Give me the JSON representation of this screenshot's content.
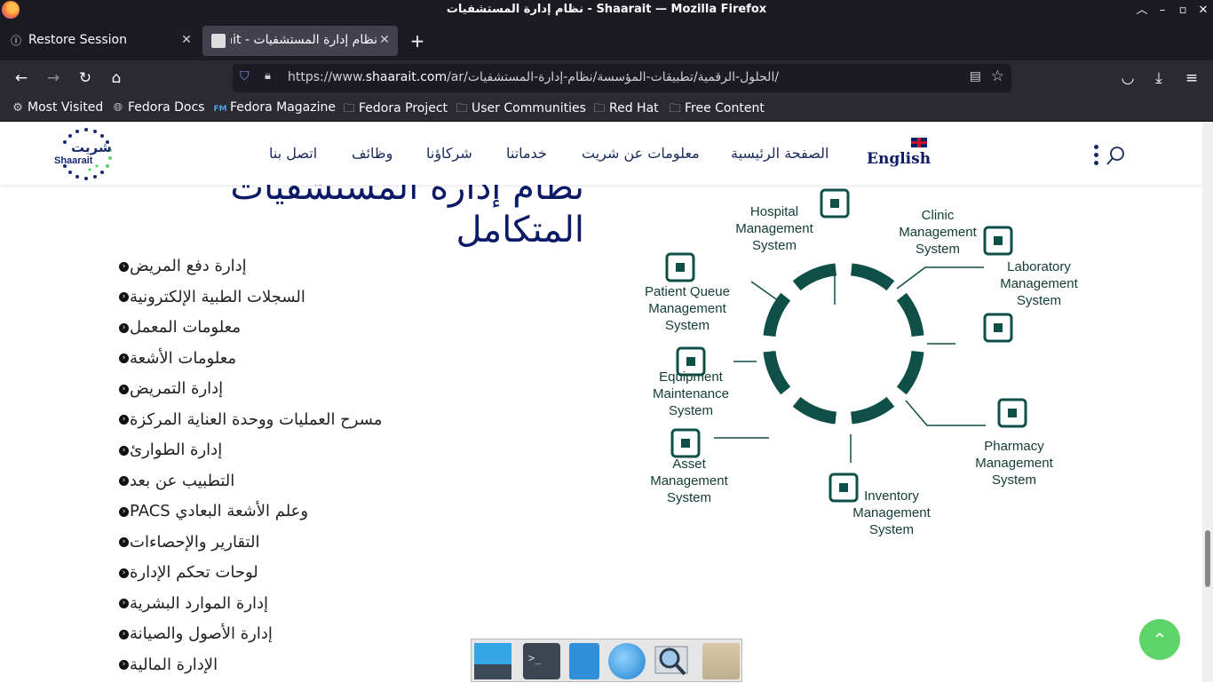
{
  "window": {
    "title": "نظام إدارة المستشفيات - Shaarait — Mozilla Firefox"
  },
  "tabs": [
    {
      "label": "Restore Session",
      "active": false
    },
    {
      "label": "نظام إدارة المستشفيات - Shaarait",
      "active": true
    }
  ],
  "url": {
    "prefix": "https://www.",
    "domain": "shaarait.com",
    "path": "/ar/الحلول-الرقمية/تطبيقات-المؤسسة/نظام-إدارة-المستشفيات/"
  },
  "bookmarks": [
    "Most Visited",
    "Fedora Docs",
    "Fedora Magazine",
    "Fedora Project",
    "User Communities",
    "Red Hat",
    "Free Content"
  ],
  "site": {
    "logo_text": "شريت",
    "logo_sub": "Shaarait",
    "menu": [
      "الصفحة الرئيسية",
      "معلومات عن شريت",
      "خدماتنا",
      "شركاؤنا",
      "وظائف",
      "اتصل بنا"
    ],
    "lang_label": "English"
  },
  "heading": {
    "line1": "نظام إدارة المستشفيات",
    "line2": "المتكامل"
  },
  "features": [
    "إدارة دفع المريض",
    "السجلات الطبية الإلكترونية",
    "معلومات المعمل",
    "معلومات الأشعة",
    "إدارة التمريض",
    "مسرح العمليات ووحدة العناية المركزة",
    "إدارة الطوارئ",
    "التطبيب عن بعد",
    "PACS وعلم الأشعة البعادي",
    "التقارير والإحصاءات",
    "لوحات تحكم الإدارة",
    "إدارة الموارد البشرية",
    "إدارة الأصول والصيانة",
    "الإدارة المالية"
  ],
  "diagram": {
    "color": "#0e4f47",
    "modules": [
      {
        "name": "Hospital Management System",
        "lines": [
          "Hospital",
          "Management",
          "System"
        ],
        "icon": "hospital-icon"
      },
      {
        "name": "Clinic Management System",
        "lines": [
          "Clinic",
          "Management",
          "System"
        ],
        "icon": "clipboard-chart-icon"
      },
      {
        "name": "Laboratory Management System",
        "lines": [
          "Laboratory",
          "Management",
          "System"
        ],
        "icon": "flask-icon"
      },
      {
        "name": "Pharmacy Management System",
        "lines": [
          "Pharmacy",
          "Management",
          "System"
        ],
        "icon": "medicine-bottle-icon"
      },
      {
        "name": "Inventory Management System",
        "lines": [
          "Inventory",
          "Management",
          "System"
        ],
        "icon": "checklist-icon"
      },
      {
        "name": "Asset Management System",
        "lines": [
          "Asset",
          "Management",
          "System"
        ],
        "icon": "house-gear-icon"
      },
      {
        "name": "Equipment Maintenance System",
        "lines": [
          "Equipment",
          "Maintenance",
          "System"
        ],
        "icon": "toolbox-icon"
      },
      {
        "name": "Patient Queue Management System",
        "lines": [
          "Patient Queue",
          "Management",
          "System"
        ],
        "icon": "queue-people-icon"
      }
    ]
  },
  "taskbar": [
    "workspace-switcher",
    "terminal",
    "file-cabinet",
    "browser",
    "image-viewer",
    "files"
  ]
}
